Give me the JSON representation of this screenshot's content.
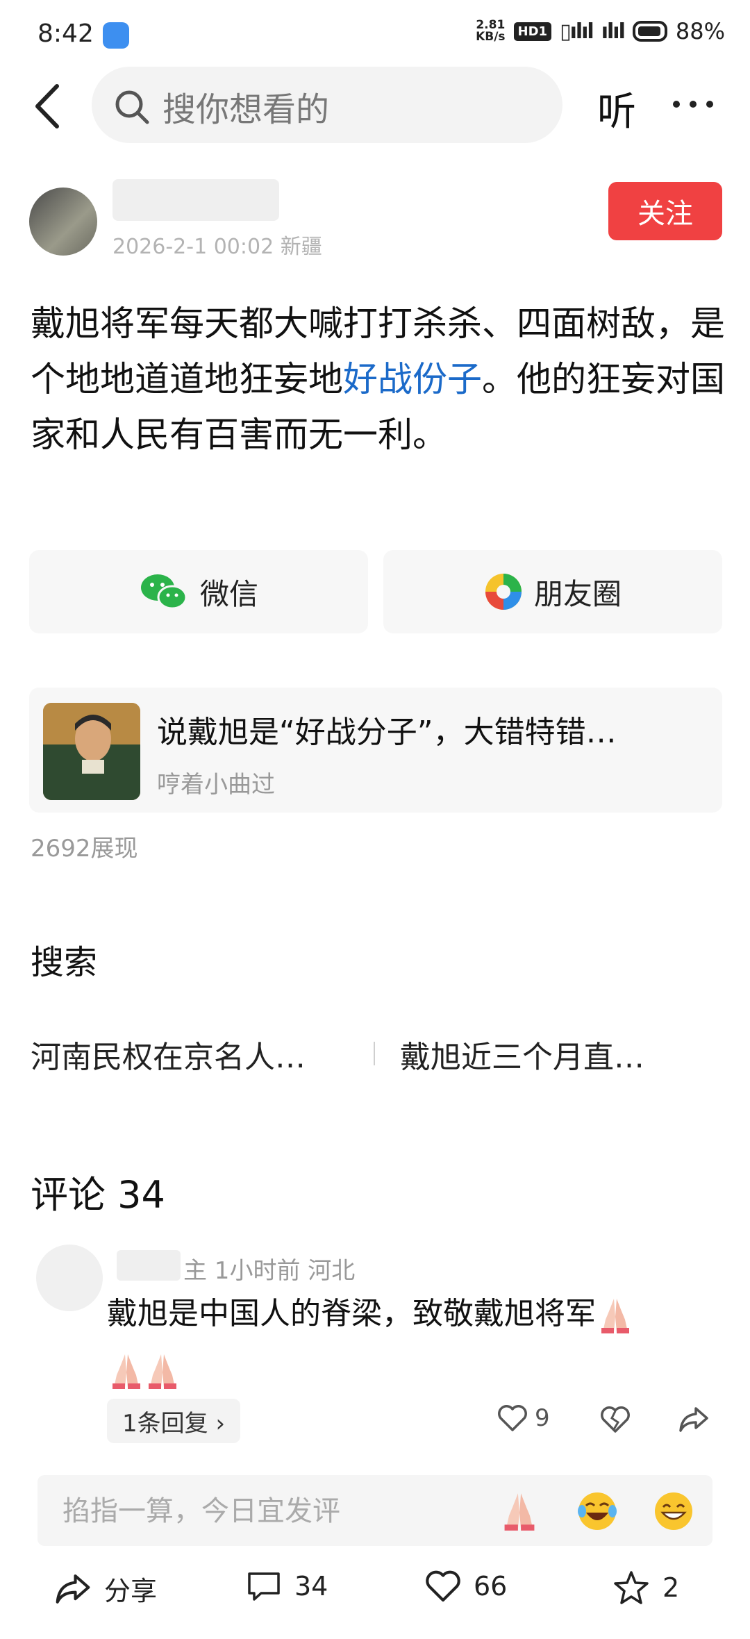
{
  "status_bar": {
    "time": "8:42",
    "net_speed_value": "2.81",
    "net_speed_unit": "KB/s",
    "hd_badge": "HD1",
    "battery": "88%"
  },
  "top_nav": {
    "search_placeholder": "搜你想看的",
    "listen_label": "听"
  },
  "author": {
    "post_time": "2026-2-1 00:02 新疆",
    "follow_label": "关注"
  },
  "post": {
    "text_before_link": "戴旭将军每天都大喊打打杀杀、四面树敌，是个地地道道地狂妄地",
    "link_text": "好战份子",
    "text_after_link": "。他的狂妄对国家和人民有百害而无一利。"
  },
  "share": {
    "wechat_label": "微信",
    "moments_label": "朋友圈"
  },
  "related": {
    "title": "说戴旭是“好战分子”，大错特错…",
    "source": "哼着小曲过",
    "views": "2692展现"
  },
  "search_section": {
    "heading": "搜索",
    "hot_items": [
      "河南民权在京名人…",
      "戴旭近三个月直…"
    ]
  },
  "comments": {
    "heading": "评论 34",
    "items": [
      {
        "meta": "主  1小时前  河北",
        "text": "戴旭是中国人的脊梁，致敬戴旭将军",
        "reply_label": "1条回复 ›",
        "likes": "9"
      }
    ]
  },
  "comment_input": {
    "placeholder": "掐指一算，今日宜发评"
  },
  "bottom_bar": {
    "share_label": "分享",
    "comment_count": "34",
    "like_count": "66",
    "favorite_count": "2"
  },
  "colors": {
    "accent_red": "#f04142",
    "link_blue": "#1b6ac9",
    "wechat_green": "#2bb34a"
  }
}
